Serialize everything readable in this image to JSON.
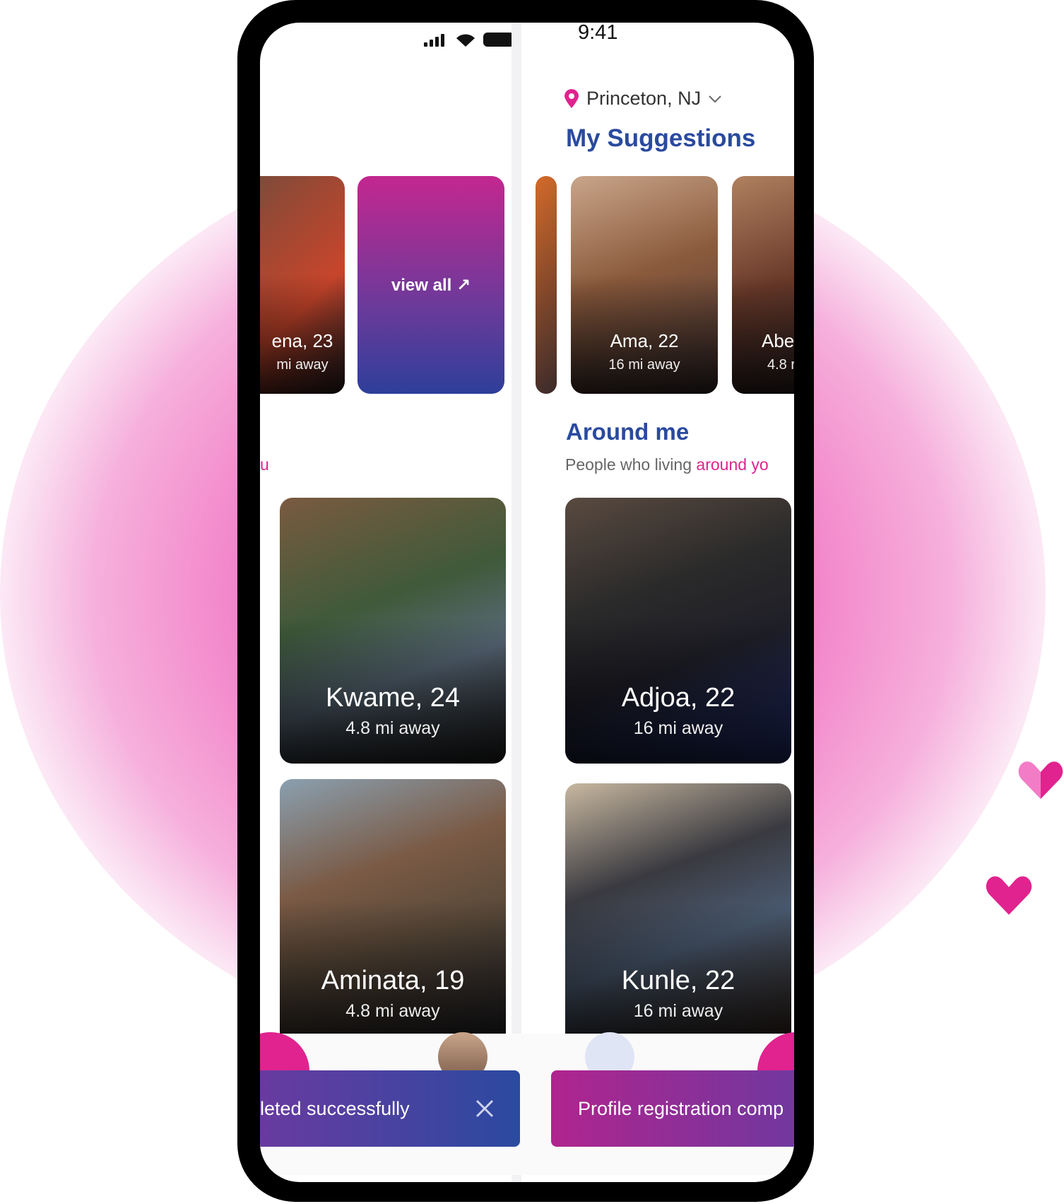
{
  "status": {
    "time": "9:41"
  },
  "location": {
    "label": "Princeton, NJ"
  },
  "suggestions": {
    "title": "My Suggestions",
    "view_all_label": "view all ↗",
    "left_card": {
      "name": "ena, 23",
      "distance": "mi away"
    },
    "cards": [
      {
        "name": "Ama, 22",
        "distance": "16 mi away"
      },
      {
        "name": "Abe",
        "distance": "4.8 r"
      }
    ]
  },
  "around_me": {
    "title": "Around me",
    "subtitle_plain": "People who living ",
    "subtitle_accent": "around yo",
    "left_fragment": "u",
    "cards": [
      {
        "name": "Kwame, 24",
        "distance": "4.8 mi away"
      },
      {
        "name": "Adjoa, 22",
        "distance": "16 mi away"
      },
      {
        "name": "Aminata, 19",
        "distance": "4.8 mi away"
      },
      {
        "name": "Kunle, 22",
        "distance": "16 mi away"
      }
    ]
  },
  "toasts": {
    "left": "leted successfully",
    "right": "Profile registration comp"
  },
  "colors": {
    "accent_pink": "#e0238e",
    "heading_blue": "#2a4a9e"
  }
}
